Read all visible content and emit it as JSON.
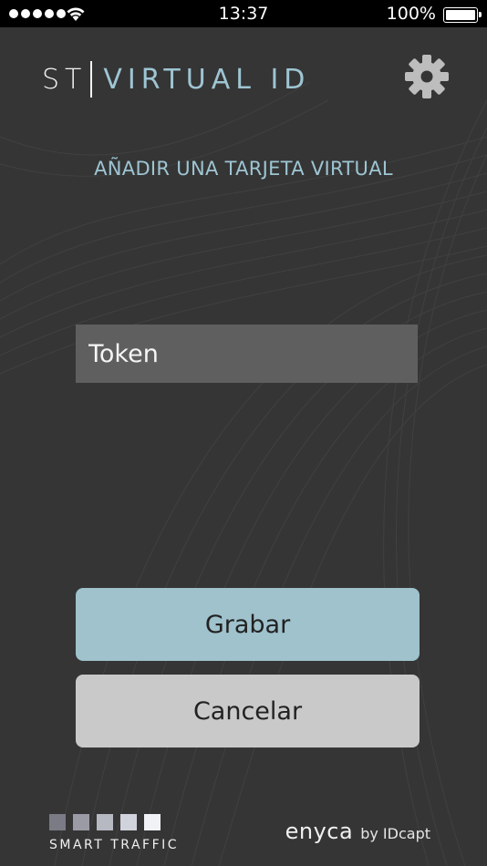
{
  "status_bar": {
    "time": "13:37",
    "battery": "100%",
    "icons": [
      "signal-dots-icon",
      "wifi-icon",
      "battery-icon"
    ]
  },
  "brand": {
    "st": "ST",
    "virtual_id": "VIRTUAL ID"
  },
  "heading": "AÑADIR UNA TARJETA VIRTUAL",
  "token_field": {
    "placeholder": "Token",
    "value": ""
  },
  "buttons": {
    "save": "Grabar",
    "cancel": "Cancelar"
  },
  "footer": {
    "smart_traffic": "SMART TRAFFIC",
    "smart_traffic_squares": [
      "#7a7b84",
      "#9a9ba5",
      "#b6b8c2",
      "#d1d3dc",
      "#f1f2f6"
    ],
    "enyca": "enyca",
    "by": "by IDcapt"
  },
  "colors": {
    "background": "#353535",
    "accent": "#9ec5d3",
    "save_button": "#9fc2cd",
    "cancel_button": "#c9c9c9",
    "input_background": "#5f5f5f"
  }
}
